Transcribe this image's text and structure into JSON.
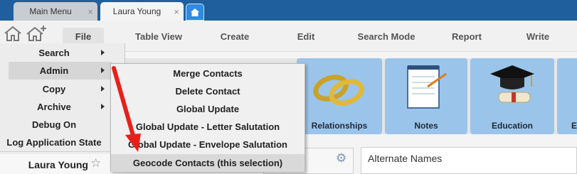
{
  "tabs": [
    {
      "label": "Main Menu",
      "close": "×"
    },
    {
      "label": "Laura Young",
      "close": "×"
    }
  ],
  "menubar": {
    "file": "File",
    "items": [
      "Table View",
      "Create",
      "Edit",
      "Search Mode",
      "Report",
      "Write"
    ]
  },
  "file_menu": {
    "items": [
      {
        "label": "Search"
      },
      {
        "label": "Admin"
      },
      {
        "label": "Copy"
      },
      {
        "label": "Archive"
      },
      {
        "label": "Debug On"
      },
      {
        "label": "Log Application State"
      }
    ],
    "user": {
      "name": "Laura Young",
      "star": "☆"
    }
  },
  "admin_submenu": {
    "items": [
      "Merge Contacts",
      "Delete Contact",
      "Global Update",
      "Global Update - Letter Salutation",
      "Global Update - Envelope Salutation",
      "Geocode Contacts (this selection)"
    ]
  },
  "tiles": [
    {
      "label": "Relationships",
      "icon": "rings-icon"
    },
    {
      "label": "Notes",
      "icon": "notepad-icon"
    },
    {
      "label": "Education",
      "icon": "graduation-cap-icon"
    },
    {
      "label": "E",
      "icon": "partial-icon"
    }
  ],
  "panels": {
    "alternate_names": "Alternate Names"
  },
  "colors": {
    "tabstrip": "#1f5f9e",
    "tile": "#9bc4ea",
    "arrow": "#e8201a"
  }
}
